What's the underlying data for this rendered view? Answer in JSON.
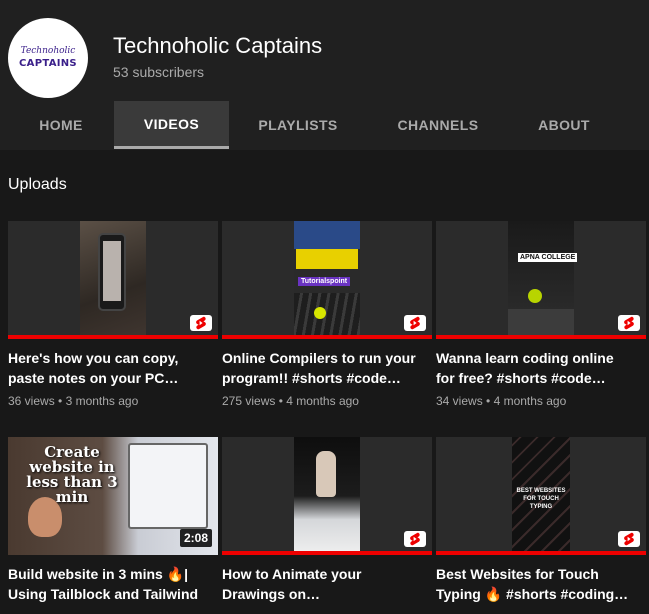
{
  "channel": {
    "name": "Technoholic Captains",
    "subscribers": "53 subscribers",
    "avatar_script": "Technoholic",
    "avatar_brand": "CAPTAINS"
  },
  "tabs": [
    {
      "label": "HOME",
      "active": false
    },
    {
      "label": "VIDEOS",
      "active": true
    },
    {
      "label": "PLAYLISTS",
      "active": false
    },
    {
      "label": "CHANNELS",
      "active": false
    },
    {
      "label": "ABOUT",
      "active": false
    }
  ],
  "section": {
    "title": "Uploads"
  },
  "videos": [
    {
      "title": "Here's how you can copy, paste notes on your PC…",
      "views": "36 views",
      "age": "3 months ago",
      "type": "short"
    },
    {
      "title": "Online Compilers to run your program!! #shorts #code…",
      "views": "275 views",
      "age": "4 months ago",
      "type": "short",
      "thumb_text": "Tutorialspoint"
    },
    {
      "title": "Wanna learn coding online for free? #shorts #code…",
      "views": "34 views",
      "age": "4 months ago",
      "type": "short",
      "thumb_text": "APNA COLLEGE"
    },
    {
      "title": "Build website in 3 mins 🔥| Using Tailblock and Tailwind",
      "views": "",
      "age": "",
      "type": "video",
      "duration": "2:08",
      "thumb_text": "Create website in less than 3 min"
    },
    {
      "title": "How to Animate your Drawings on…",
      "views": "",
      "age": "",
      "type": "short"
    },
    {
      "title": "Best Websites for Touch Typing 🔥 #shorts #coding…",
      "views": "",
      "age": "",
      "type": "short",
      "thumb_text": "BEST WEBSITES FOR TOUCH TYPING"
    }
  ],
  "colors": {
    "progress": "#ee0000",
    "accent": "#3ea6ff",
    "background": "#181818"
  }
}
